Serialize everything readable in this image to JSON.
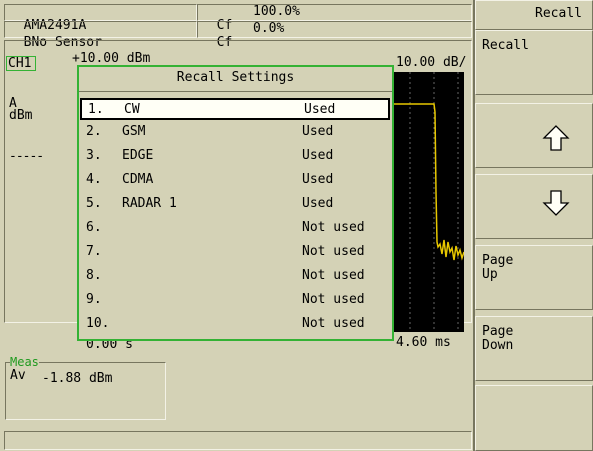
{
  "header": {
    "sensor_a": "MA2491A",
    "sensor_a_channel": "A",
    "sensor_b": "No Sensor",
    "sensor_b_channel": "B",
    "cf_a_label": "Cf",
    "cf_a_value": "100.0%",
    "cf_b_label": "Cf",
    "cf_b_value": "0.0%"
  },
  "trace": {
    "channel": "CH1",
    "top_left_partial": "+10.00 dBm",
    "top_right": "10.00 dB/",
    "source": "A",
    "unit": "dBm",
    "marker_line": "-----",
    "bottom_left_partial": "0.00 s",
    "bottom_right": "4.60 ms"
  },
  "measurement": {
    "group_label": "Meas",
    "mode": "Av",
    "value": "-1.88 dBm"
  },
  "dialog": {
    "title": "Recall Settings",
    "items": [
      {
        "num": "1.",
        "name": "CW",
        "status": "Used"
      },
      {
        "num": "2.",
        "name": "GSM",
        "status": "Used"
      },
      {
        "num": "3.",
        "name": "EDGE",
        "status": "Used"
      },
      {
        "num": "4.",
        "name": "CDMA",
        "status": "Used"
      },
      {
        "num": "5.",
        "name": "RADAR 1",
        "status": "Used"
      },
      {
        "num": "6.",
        "name": "",
        "status": "Not used"
      },
      {
        "num": "7.",
        "name": "",
        "status": "Not used"
      },
      {
        "num": "8.",
        "name": "",
        "status": "Not used"
      },
      {
        "num": "9.",
        "name": "",
        "status": "Not used"
      },
      {
        "num": "10.",
        "name": "",
        "status": "Not used"
      }
    ],
    "selected_index": 0
  },
  "softkeys": {
    "menu_title": "Recall",
    "recall": "Recall",
    "up_icon": "up-arrow-icon",
    "down_icon": "down-arrow-icon",
    "page_up_line1": "Page",
    "page_up_line2": "Up",
    "page_down_line1": "Page",
    "page_down_line2": "Down"
  },
  "colors": {
    "panel": "#d4d2b6",
    "dialog_border": "#34b234",
    "trace": "#e8c800",
    "graph_bg": "#000000",
    "meas_label": "#1f9a1f"
  }
}
